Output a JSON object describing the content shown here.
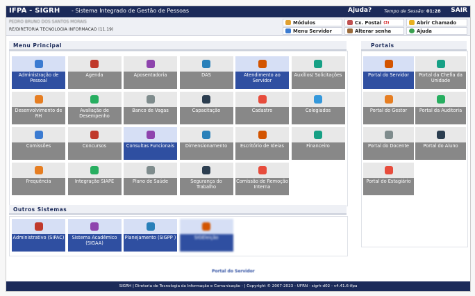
{
  "header": {
    "brand": "IFPA - SIGRH",
    "subtitle": "- Sistema Integrado de Gestão de Pessoas",
    "help": "Ajuda?",
    "session_label": "Tempo de Sessão:",
    "session_time": "01:28",
    "exit": "SAIR"
  },
  "user": {
    "name": "PEDRO BRUNO DOS SANTOS MORAIS",
    "department": "RE/DIRETORIA TECNOLOGIA INFORMACAO (11.19)"
  },
  "quick_links": {
    "modules": "Módulos",
    "mailbox": "Cx. Postal",
    "mailbox_count": "(3)",
    "ticket": "Abrir Chamado",
    "server_menu": "Menu Servidor",
    "change_password": "Alterar senha",
    "help": "Ajuda"
  },
  "main_menu": {
    "title": "Menu Principal",
    "tiles": [
      {
        "label": "Administração de Pessoal",
        "active": true,
        "icon": "admin-icon"
      },
      {
        "label": "Agenda",
        "active": false,
        "icon": "calendar-icon"
      },
      {
        "label": "Aposentadoria",
        "active": false,
        "icon": "calendar-icon"
      },
      {
        "label": "DAS",
        "active": false,
        "icon": "das-icon"
      },
      {
        "label": "Atendimento ao Servidor",
        "active": true,
        "icon": "person-icon"
      },
      {
        "label": "Auxílios/ Solicitações",
        "active": false,
        "icon": "request-icon"
      },
      {
        "label": "Desenvolvimento de RH",
        "active": false,
        "icon": "people-icon"
      },
      {
        "label": "Avaliação de Desempenho",
        "active": false,
        "icon": "evaluation-icon"
      },
      {
        "label": "Banco de Vagas",
        "active": false,
        "icon": "database-icon"
      },
      {
        "label": "Capacitação",
        "active": false,
        "icon": "training-icon"
      },
      {
        "label": "Cadastro",
        "active": false,
        "icon": "plus-icon"
      },
      {
        "label": "Colegiados",
        "active": false,
        "icon": "globe-icon"
      },
      {
        "label": "Comissões",
        "active": false,
        "icon": "group-icon"
      },
      {
        "label": "Concursos",
        "active": false,
        "icon": "edit-icon"
      },
      {
        "label": "Consultas Funcionais",
        "active": true,
        "icon": "magnifier-icon"
      },
      {
        "label": "Dimensionamento",
        "active": false,
        "icon": "cubes-icon"
      },
      {
        "label": "Escritório de Ideias",
        "active": false,
        "icon": "lightbulb-icon"
      },
      {
        "label": "Financeiro",
        "active": false,
        "icon": "money-icon"
      },
      {
        "label": "Frequência",
        "active": false,
        "icon": "checklist-icon"
      },
      {
        "label": "Integração SIAPE",
        "active": false,
        "icon": "integration-icon"
      },
      {
        "label": "Plano de Saúde",
        "active": false,
        "icon": "health-icon"
      },
      {
        "label": "Segurança do Trabalho",
        "active": false,
        "icon": "safety-icon"
      },
      {
        "label": "Comissão de Remoção Interna",
        "active": false,
        "icon": "group-icon"
      }
    ]
  },
  "portals": {
    "title": "Portais",
    "tiles": [
      {
        "label": "Portal do Servidor",
        "active": true
      },
      {
        "label": "Portal da Chefia da Unidade",
        "active": false
      },
      {
        "label": "Portal do Gestor",
        "active": false
      },
      {
        "label": "Portal da Auditoria",
        "active": false
      },
      {
        "label": "Portal do Docente",
        "active": false
      },
      {
        "label": "Portal do Aluno",
        "active": false
      },
      {
        "label": "Portal do Estagiário",
        "active": false
      }
    ]
  },
  "other_systems": {
    "title": "Outros Sistemas",
    "tiles": [
      {
        "label": "Administrativo (SIPAC)"
      },
      {
        "label": "Sistema Acadêmico (SIGAA)"
      },
      {
        "label": "Planejamento (SIGPP )"
      },
      {
        "label": "SIGEleição"
      }
    ],
    "tooltip": "Portal do Servidor"
  },
  "footer": "SIGRH | Diretoria de Tecnologia da Informação e Comunicação - | Copyright © 2007-2023 - UFRN - sigrh-d02 - v4.41.6-ifpa",
  "colors": {
    "navy": "#1b2a59",
    "active_blue": "#2f4fa1",
    "tile_gray": "#888888"
  }
}
